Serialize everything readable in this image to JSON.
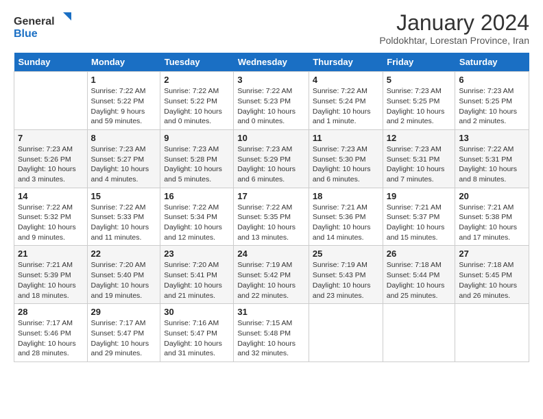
{
  "header": {
    "logo_general": "General",
    "logo_blue": "Blue",
    "month_title": "January 2024",
    "location": "Poldokhtar, Lorestan Province, Iran"
  },
  "weekdays": [
    "Sunday",
    "Monday",
    "Tuesday",
    "Wednesday",
    "Thursday",
    "Friday",
    "Saturday"
  ],
  "weeks": [
    [
      {
        "day": "",
        "info": ""
      },
      {
        "day": "1",
        "info": "Sunrise: 7:22 AM\nSunset: 5:22 PM\nDaylight: 9 hours\nand 59 minutes."
      },
      {
        "day": "2",
        "info": "Sunrise: 7:22 AM\nSunset: 5:22 PM\nDaylight: 10 hours\nand 0 minutes."
      },
      {
        "day": "3",
        "info": "Sunrise: 7:22 AM\nSunset: 5:23 PM\nDaylight: 10 hours\nand 0 minutes."
      },
      {
        "day": "4",
        "info": "Sunrise: 7:22 AM\nSunset: 5:24 PM\nDaylight: 10 hours\nand 1 minute."
      },
      {
        "day": "5",
        "info": "Sunrise: 7:23 AM\nSunset: 5:25 PM\nDaylight: 10 hours\nand 2 minutes."
      },
      {
        "day": "6",
        "info": "Sunrise: 7:23 AM\nSunset: 5:25 PM\nDaylight: 10 hours\nand 2 minutes."
      }
    ],
    [
      {
        "day": "7",
        "info": "Sunrise: 7:23 AM\nSunset: 5:26 PM\nDaylight: 10 hours\nand 3 minutes."
      },
      {
        "day": "8",
        "info": "Sunrise: 7:23 AM\nSunset: 5:27 PM\nDaylight: 10 hours\nand 4 minutes."
      },
      {
        "day": "9",
        "info": "Sunrise: 7:23 AM\nSunset: 5:28 PM\nDaylight: 10 hours\nand 5 minutes."
      },
      {
        "day": "10",
        "info": "Sunrise: 7:23 AM\nSunset: 5:29 PM\nDaylight: 10 hours\nand 6 minutes."
      },
      {
        "day": "11",
        "info": "Sunrise: 7:23 AM\nSunset: 5:30 PM\nDaylight: 10 hours\nand 6 minutes."
      },
      {
        "day": "12",
        "info": "Sunrise: 7:23 AM\nSunset: 5:31 PM\nDaylight: 10 hours\nand 7 minutes."
      },
      {
        "day": "13",
        "info": "Sunrise: 7:22 AM\nSunset: 5:31 PM\nDaylight: 10 hours\nand 8 minutes."
      }
    ],
    [
      {
        "day": "14",
        "info": "Sunrise: 7:22 AM\nSunset: 5:32 PM\nDaylight: 10 hours\nand 9 minutes."
      },
      {
        "day": "15",
        "info": "Sunrise: 7:22 AM\nSunset: 5:33 PM\nDaylight: 10 hours\nand 11 minutes."
      },
      {
        "day": "16",
        "info": "Sunrise: 7:22 AM\nSunset: 5:34 PM\nDaylight: 10 hours\nand 12 minutes."
      },
      {
        "day": "17",
        "info": "Sunrise: 7:22 AM\nSunset: 5:35 PM\nDaylight: 10 hours\nand 13 minutes."
      },
      {
        "day": "18",
        "info": "Sunrise: 7:21 AM\nSunset: 5:36 PM\nDaylight: 10 hours\nand 14 minutes."
      },
      {
        "day": "19",
        "info": "Sunrise: 7:21 AM\nSunset: 5:37 PM\nDaylight: 10 hours\nand 15 minutes."
      },
      {
        "day": "20",
        "info": "Sunrise: 7:21 AM\nSunset: 5:38 PM\nDaylight: 10 hours\nand 17 minutes."
      }
    ],
    [
      {
        "day": "21",
        "info": "Sunrise: 7:21 AM\nSunset: 5:39 PM\nDaylight: 10 hours\nand 18 minutes."
      },
      {
        "day": "22",
        "info": "Sunrise: 7:20 AM\nSunset: 5:40 PM\nDaylight: 10 hours\nand 19 minutes."
      },
      {
        "day": "23",
        "info": "Sunrise: 7:20 AM\nSunset: 5:41 PM\nDaylight: 10 hours\nand 21 minutes."
      },
      {
        "day": "24",
        "info": "Sunrise: 7:19 AM\nSunset: 5:42 PM\nDaylight: 10 hours\nand 22 minutes."
      },
      {
        "day": "25",
        "info": "Sunrise: 7:19 AM\nSunset: 5:43 PM\nDaylight: 10 hours\nand 23 minutes."
      },
      {
        "day": "26",
        "info": "Sunrise: 7:18 AM\nSunset: 5:44 PM\nDaylight: 10 hours\nand 25 minutes."
      },
      {
        "day": "27",
        "info": "Sunrise: 7:18 AM\nSunset: 5:45 PM\nDaylight: 10 hours\nand 26 minutes."
      }
    ],
    [
      {
        "day": "28",
        "info": "Sunrise: 7:17 AM\nSunset: 5:46 PM\nDaylight: 10 hours\nand 28 minutes."
      },
      {
        "day": "29",
        "info": "Sunrise: 7:17 AM\nSunset: 5:47 PM\nDaylight: 10 hours\nand 29 minutes."
      },
      {
        "day": "30",
        "info": "Sunrise: 7:16 AM\nSunset: 5:47 PM\nDaylight: 10 hours\nand 31 minutes."
      },
      {
        "day": "31",
        "info": "Sunrise: 7:15 AM\nSunset: 5:48 PM\nDaylight: 10 hours\nand 32 minutes."
      },
      {
        "day": "",
        "info": ""
      },
      {
        "day": "",
        "info": ""
      },
      {
        "day": "",
        "info": ""
      }
    ]
  ]
}
